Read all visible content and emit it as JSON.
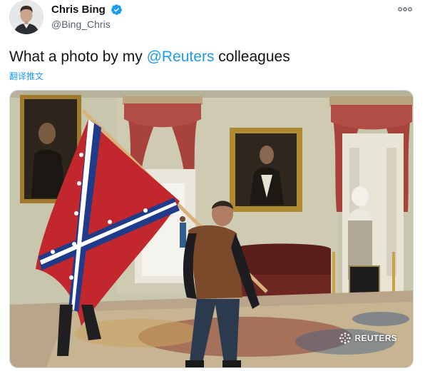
{
  "author": {
    "display_name": "Chris Bing",
    "handle": "@Bing_Chris",
    "verified_icon": "verified-badge-icon",
    "avatar_icon": "avatar"
  },
  "menu": {
    "icon": "more-options-icon"
  },
  "tweet": {
    "text_prefix": "What a photo by my ",
    "mention": "@Reuters",
    "text_suffix": " colleagues",
    "translate_label": "翻译推文"
  },
  "media": {
    "watermark": "REUTERS",
    "watermark_icon": "reuters-logo-icon"
  },
  "colors": {
    "link": "#1d9bf0",
    "verified": "#1d9bf0",
    "text": "#0f1419",
    "secondary": "#536471"
  }
}
